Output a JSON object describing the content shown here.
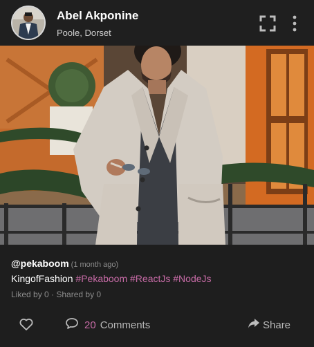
{
  "post": {
    "user": {
      "name": "Abel Akponine",
      "location": "Poole, Dorset",
      "avatar_icon": "user-avatar"
    },
    "header_actions": {
      "fullscreen_icon": "fullscreen-icon",
      "more_icon": "vertical-dots-icon"
    },
    "image": {
      "subject_icon": "fashion-photo"
    },
    "caption": {
      "handle": "@pekaboom",
      "time": "(1 month ago)",
      "text": "KingofFashion",
      "hashtags": [
        "#Pekaboom",
        "#ReactJs",
        "#NodeJs"
      ]
    },
    "stats": {
      "text": "Liked by 0 · Shared by 0"
    },
    "actions": {
      "like_icon": "heart-outline-icon",
      "comments_count": "20",
      "comments_label": "Comments",
      "share_label": "Share"
    },
    "colors": {
      "accent": "#c76ba6",
      "background": "#1e1e1e",
      "muted": "#8d8d8d"
    }
  }
}
